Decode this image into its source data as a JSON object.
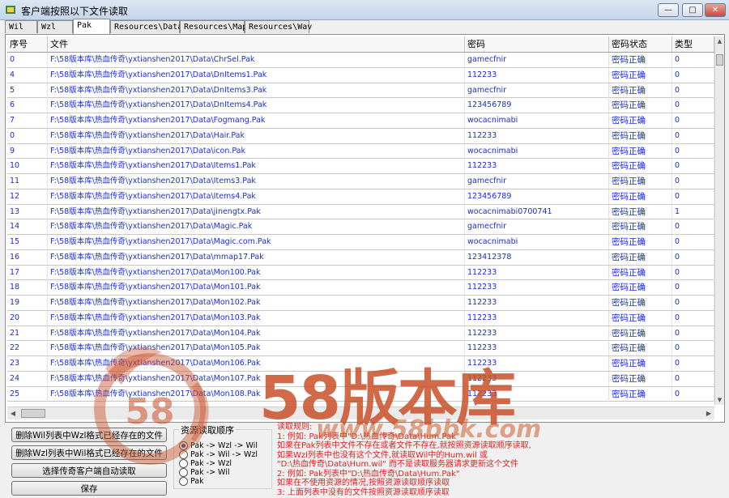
{
  "window": {
    "title": "客户端按照以下文件读取",
    "min": "—",
    "max": "□",
    "close": "✕"
  },
  "tabs": [
    "Wil",
    "Wzl",
    "Pak",
    "Resources\\Data",
    "Resources\\Map",
    "Resources\\Wav"
  ],
  "active_tab": "Pak",
  "table": {
    "headers": [
      "序号",
      "文件",
      "密码",
      "密码状态",
      "类型"
    ],
    "rows": [
      [
        "0",
        "F:\\58版本库\\热血传奇\\yxtianshen2017\\Data\\ChrSel.Pak",
        "gamecfnir",
        "密码正确",
        "0"
      ],
      [
        "4",
        "F:\\58版本库\\热血传奇\\yxtianshen2017\\Data\\DnItems1.Pak",
        "112233",
        "密码正确",
        "0"
      ],
      [
        "5",
        "F:\\58版本库\\热血传奇\\yxtianshen2017\\Data\\DnItems3.Pak",
        "gamecfnir",
        "密码正确",
        "0"
      ],
      [
        "6",
        "F:\\58版本库\\热血传奇\\yxtianshen2017\\Data\\DnItems4.Pak",
        "123456789",
        "密码正确",
        "0"
      ],
      [
        "7",
        "F:\\58版本库\\热血传奇\\yxtianshen2017\\Data\\Fogmang.Pak",
        "wocacnimabi",
        "密码正确",
        "0"
      ],
      [
        "0",
        "F:\\58版本库\\热血传奇\\yxtianshen2017\\Data\\Hair.Pak",
        "112233",
        "密码正确",
        "0"
      ],
      [
        "9",
        "F:\\58版本库\\热血传奇\\yxtianshen2017\\Data\\icon.Pak",
        "wocacnimabi",
        "密码正确",
        "0"
      ],
      [
        "10",
        "F:\\58版本库\\热血传奇\\yxtianshen2017\\Data\\Items1.Pak",
        "112233",
        "密码正确",
        "0"
      ],
      [
        "11",
        "F:\\58版本库\\热血传奇\\yxtianshen2017\\Data\\Items3.Pak",
        "gamecfnir",
        "密码正确",
        "0"
      ],
      [
        "12",
        "F:\\58版本库\\热血传奇\\yxtianshen2017\\Data\\Items4.Pak",
        "123456789",
        "密码正确",
        "0"
      ],
      [
        "13",
        "F:\\58版本库\\热血传奇\\yxtianshen2017\\Data\\jinengtx.Pak",
        "wocacnimabi0700741",
        "密码正确",
        "1"
      ],
      [
        "14",
        "F:\\58版本库\\热血传奇\\yxtianshen2017\\Data\\Magic.Pak",
        "gamecfnir",
        "密码正确",
        "0"
      ],
      [
        "15",
        "F:\\58版本库\\热血传奇\\yxtianshen2017\\Data\\Magic.com.Pak",
        "wocacnimabi",
        "密码正确",
        "0"
      ],
      [
        "16",
        "F:\\58版本库\\热血传奇\\yxtianshen2017\\Data\\mmap17.Pak",
        "123412378",
        "密码正确",
        "0"
      ],
      [
        "17",
        "F:\\58版本库\\热血传奇\\yxtianshen2017\\Data\\Mon100.Pak",
        "112233",
        "密码正确",
        "0"
      ],
      [
        "18",
        "F:\\58版本库\\热血传奇\\yxtianshen2017\\Data\\Mon101.Pak",
        "112233",
        "密码正确",
        "0"
      ],
      [
        "19",
        "F:\\58版本库\\热血传奇\\yxtianshen2017\\Data\\Mon102.Pak",
        "112233",
        "密码正确",
        "0"
      ],
      [
        "20",
        "F:\\58版本库\\热血传奇\\yxtianshen2017\\Data\\Mon103.Pak",
        "112233",
        "密码正确",
        "0"
      ],
      [
        "21",
        "F:\\58版本库\\热血传奇\\yxtianshen2017\\Data\\Mon104.Pak",
        "112233",
        "密码正确",
        "0"
      ],
      [
        "22",
        "F:\\58版本库\\热血传奇\\yxtianshen2017\\Data\\Mon105.Pak",
        "112233",
        "密码正确",
        "0"
      ],
      [
        "23",
        "F:\\58版本库\\热血传奇\\yxtianshen2017\\Data\\Mon106.Pak",
        "112233",
        "密码正确",
        "0"
      ],
      [
        "24",
        "F:\\58版本库\\热血传奇\\yxtianshen2017\\Data\\Mon107.Pak",
        "112233",
        "密码正确",
        "0"
      ],
      [
        "25",
        "F:\\58版本库\\热血传奇\\yxtianshen2017\\Data\\Mon108.Pak",
        "112233",
        "密码正确",
        "0"
      ]
    ]
  },
  "buttons": {
    "delete_wil": "删除Wil列表中Wzl格式已经存在的文件",
    "delete_wzl": "删除Wzl列表中Wil格式已经存在的文件",
    "auto_read": "选择传奇客户端自动读取",
    "save": "保存"
  },
  "read_order": {
    "title": "资源读取顺序",
    "options": [
      "Pak -> Wzl -> Wil",
      "Pak -> Wil -> Wzl",
      "Pak -> Wzl",
      "Pak -> Wil",
      "Pak"
    ],
    "selected": 0
  },
  "rules": {
    "title": "读取规则:",
    "lines": [
      "1: 例如: Pak列表中\"D:\\热血传奇\\Data\\Hum.Pak\"",
      "   如果在Pak列表中文件不存在或者文件不存在,就按照资源读取顺序读取,",
      "   如果Wzl列表中也没有这个文件,就读取Wil中的Hum.wil 或",
      "   \"D:\\热血传奇\\Data\\Hum.wil\" 而不是读取服务器请求更新这个文件",
      "2: 例如: Pak列表中\"D:\\热血传奇\\Data\\Hum.Pak\"",
      "   如果在不使用资源的情况,按照资源读取顺序读取",
      "3: 上面列表中没有的文件按照资源读取顺序读取"
    ]
  },
  "watermark": {
    "brand": "58版本库",
    "url": "www.58bbk.com",
    "logo_text": "58"
  },
  "colors": {
    "table_text": "#1a2ed0",
    "rules_text": "#e02020",
    "watermark": "#c85028"
  }
}
